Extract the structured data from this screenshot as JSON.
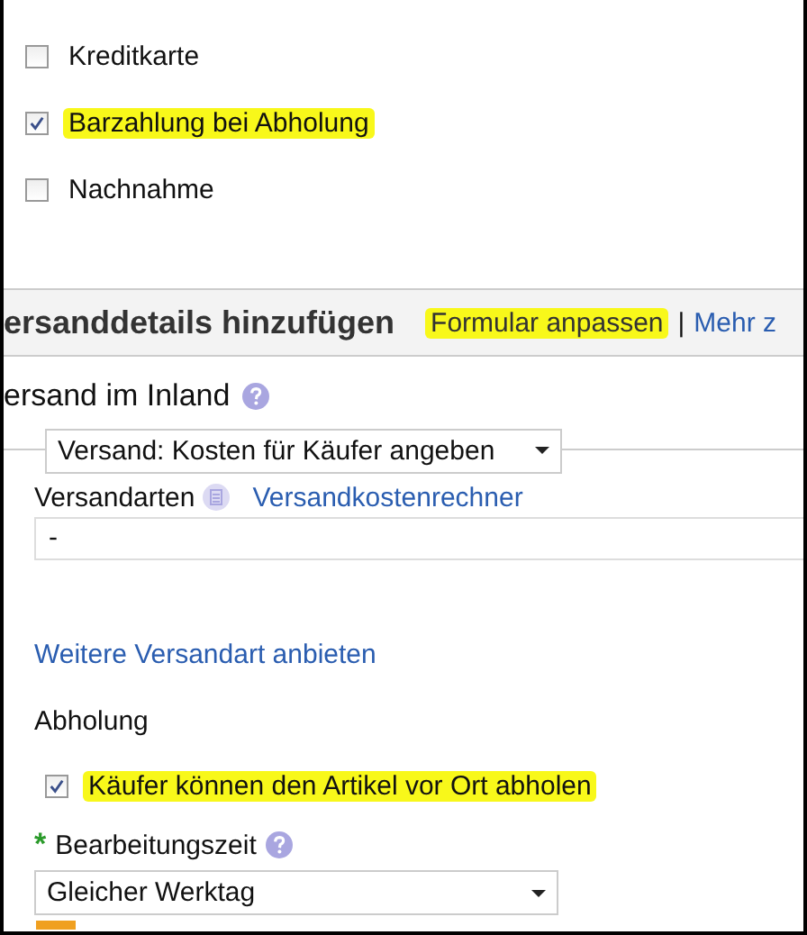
{
  "payment_options": [
    {
      "label": "Kreditkarte",
      "checked": false,
      "highlighted": false
    },
    {
      "label": "Barzahlung bei Abholung",
      "checked": true,
      "highlighted": true
    },
    {
      "label": "Nachnahme",
      "checked": false,
      "highlighted": false
    }
  ],
  "section": {
    "title": "ersanddetails hinzufügen",
    "links": [
      {
        "label": "Formular anpassen",
        "highlighted": true
      },
      {
        "label": "Mehr z",
        "highlighted": false
      }
    ],
    "separator": "|"
  },
  "domestic": {
    "title": "ersand im Inland",
    "shipping_select": "Versand: Kosten für Käufer angeben",
    "methods_label": "Versandarten",
    "calculator_link": "Versandkostenrechner",
    "method_field": "-",
    "add_link": "Weitere Versandart anbieten"
  },
  "pickup": {
    "title": "Abholung",
    "option": {
      "label": "Käufer können den Artikel vor Ort abholen",
      "checked": true,
      "highlighted": true
    }
  },
  "handling": {
    "required_mark": "*",
    "label": "Bearbeitungszeit",
    "value": "Gleicher Werktag"
  }
}
